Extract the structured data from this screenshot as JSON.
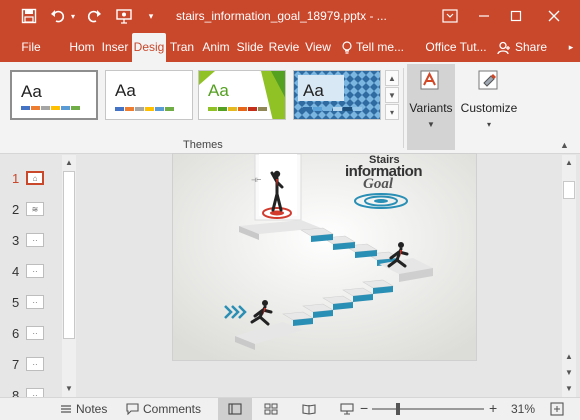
{
  "titlebar": {
    "title": "stairs_information_goal_18979.pptx - ...",
    "icons": [
      "save-icon",
      "undo-icon",
      "undo-dropdown-icon",
      "redo-icon",
      "slideshow-icon",
      "customize-qat-icon"
    ],
    "window": [
      "ribbon-display-icon",
      "minimize-icon",
      "maximize-icon",
      "close-icon"
    ]
  },
  "tabs": {
    "file": "File",
    "home": "Hom",
    "insert": "Inser",
    "design": "Desig",
    "transitions": "Tran",
    "animations": "Anim",
    "slideshow": "Slide",
    "review": "Revie",
    "view": "View",
    "tell_me": "Tell me...",
    "office_tutorials": "Office Tut...",
    "share": "Share"
  },
  "ribbon": {
    "themes_label": "Themes",
    "theme_sample": "Aa",
    "themes": [
      {
        "name": "office-theme",
        "selected": true,
        "bars": [
          "#4472c4",
          "#ed7d31",
          "#a5a5a5",
          "#ffc000",
          "#5b9bd5",
          "#70ad47"
        ]
      },
      {
        "name": "office-theme-2",
        "selected": false,
        "bars": [
          "#4472c4",
          "#ed7d31",
          "#a5a5a5",
          "#ffc000",
          "#5b9bd5",
          "#70ad47"
        ]
      },
      {
        "name": "facet-theme",
        "selected": false,
        "bars": [
          "#90c226",
          "#54a021",
          "#e6b91e",
          "#e76618",
          "#c42f1a",
          "#918655"
        ]
      },
      {
        "name": "patterned-theme",
        "selected": false,
        "bars": [
          "#2f6aa1",
          "#5aa2d8",
          "#7ab6e0",
          "#b6d6ee",
          "#1e4f7a",
          "#92c5e8"
        ]
      }
    ],
    "variants_label": "Variants",
    "customize_label": "Customize"
  },
  "thumbnails": [
    {
      "num": "1",
      "active": true
    },
    {
      "num": "2",
      "active": false
    },
    {
      "num": "3",
      "active": false
    },
    {
      "num": "4",
      "active": false
    },
    {
      "num": "5",
      "active": false
    },
    {
      "num": "6",
      "active": false
    },
    {
      "num": "7",
      "active": false
    },
    {
      "num": "8",
      "active": false
    }
  ],
  "slide": {
    "title_line1": "Stairs",
    "title_line2": "information",
    "title_line3": "Goal"
  },
  "status": {
    "notes": "Notes",
    "comments": "Comments",
    "zoom": "31%",
    "zoom_level": 0.31
  },
  "colors": {
    "accent": "#c9472b",
    "stair_blue": "#2a8fb5"
  }
}
